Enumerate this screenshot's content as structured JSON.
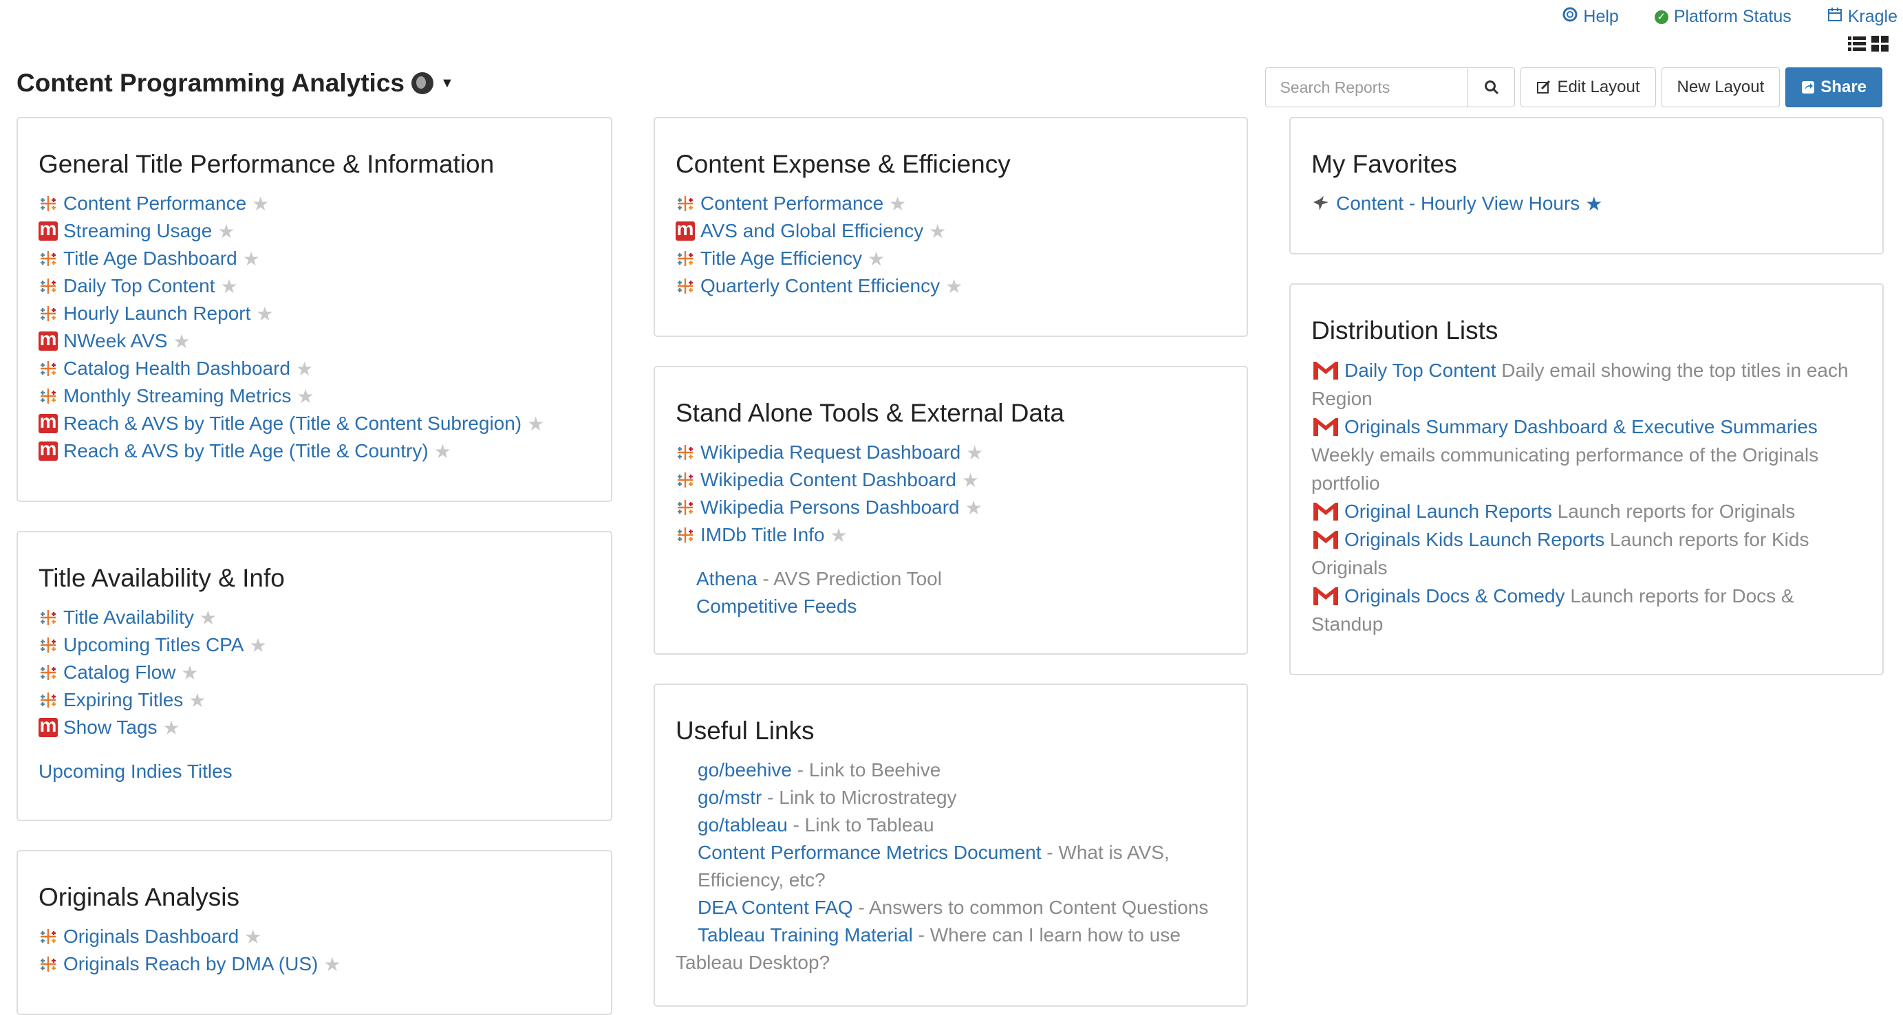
{
  "topnav": {
    "help": "Help",
    "platform_status": "Platform Status",
    "kragle": "Kragle"
  },
  "header": {
    "title": "Content Programming Analytics"
  },
  "toolbar": {
    "search_placeholder": "Search Reports",
    "edit_layout": "Edit Layout",
    "new_layout": "New Layout",
    "share": "Share"
  },
  "panels": {
    "general": {
      "title": "General Title Performance & Information",
      "items": [
        {
          "label": "Content Performance",
          "icon": "tableau-icon"
        },
        {
          "label": "Streaming Usage",
          "icon": "microstrategy-icon"
        },
        {
          "label": "Title Age Dashboard",
          "icon": "tableau-icon"
        },
        {
          "label": "Daily Top Content",
          "icon": "tableau-icon"
        },
        {
          "label": "Hourly Launch Report",
          "icon": "tableau-icon"
        },
        {
          "label": "NWeek AVS",
          "icon": "microstrategy-icon"
        },
        {
          "label": "Catalog Health Dashboard",
          "icon": "tableau-icon"
        },
        {
          "label": "Monthly Streaming Metrics",
          "icon": "tableau-icon"
        },
        {
          "label": "Reach & AVS by Title Age (Title & Content Subregion)",
          "icon": "microstrategy-icon"
        },
        {
          "label": "Reach & AVS by Title Age (Title & Country)",
          "icon": "microstrategy-icon"
        }
      ]
    },
    "availability": {
      "title": "Title Availability & Info",
      "items": [
        {
          "label": "Title Availability",
          "icon": "tableau-icon"
        },
        {
          "label": "Upcoming Titles CPA",
          "icon": "tableau-icon"
        },
        {
          "label": "Catalog Flow",
          "icon": "tableau-icon"
        },
        {
          "label": "Expiring Titles",
          "icon": "tableau-icon"
        },
        {
          "label": "Show Tags",
          "icon": "microstrategy-icon"
        }
      ],
      "extra_link": "Upcoming Indies Titles"
    },
    "originals": {
      "title": "Originals Analysis",
      "items": [
        {
          "label": "Originals Dashboard",
          "icon": "tableau-icon"
        },
        {
          "label": "Originals Reach by DMA (US)",
          "icon": "tableau-icon"
        }
      ]
    },
    "expense": {
      "title": "Content Expense & Efficiency",
      "items": [
        {
          "label": "Content Performance",
          "icon": "tableau-icon"
        },
        {
          "label": "AVS and Global Efficiency",
          "icon": "microstrategy-icon"
        },
        {
          "label": "Title Age Efficiency",
          "icon": "tableau-icon"
        },
        {
          "label": "Quarterly Content Efficiency",
          "icon": "tableau-icon"
        }
      ]
    },
    "standalone": {
      "title": "Stand Alone Tools & External Data",
      "items": [
        {
          "label": "Wikipedia Request Dashboard",
          "icon": "tableau-icon"
        },
        {
          "label": "Wikipedia Content Dashboard",
          "icon": "tableau-icon"
        },
        {
          "label": "Wikipedia Persons Dashboard",
          "icon": "tableau-icon"
        },
        {
          "label": "IMDb Title Info",
          "icon": "tableau-icon"
        }
      ],
      "athena_link": "Athena",
      "athena_desc": " - AVS Prediction Tool",
      "competitive_link": "Competitive Feeds"
    },
    "useful": {
      "title": "Useful Links",
      "links": [
        {
          "link": "go/beehive",
          "desc": " - Link to Beehive"
        },
        {
          "link": "go/mstr",
          "desc": " - Link to Microstrategy"
        },
        {
          "link": "go/tableau",
          "desc": " - Link to Tableau"
        },
        {
          "link": "Content Performance Metrics Document",
          "desc": " - What is AVS, Efficiency, etc?"
        },
        {
          "link": "DEA Content FAQ",
          "desc": " - Answers to common Content Questions"
        },
        {
          "link": "Tableau Training Material",
          "desc": " - Where can I learn how to use Tableau Desktop?"
        }
      ]
    },
    "favorites": {
      "title": "My Favorites",
      "items": [
        {
          "label": "Content - Hourly View Hours",
          "icon": "bird-icon"
        }
      ]
    },
    "distribution": {
      "title": "Distribution Lists",
      "items": [
        {
          "link": "Daily Top Content",
          "desc": " Daily email showing the top titles in each Region"
        },
        {
          "link": "Originals Summary Dashboard & Executive Summaries",
          "desc": " Weekly emails communicating performance of the Originals portfolio"
        },
        {
          "link": "Original Launch Reports",
          "desc": " Launch reports for Originals"
        },
        {
          "link": "Originals Kids Launch Reports",
          "desc": " Launch reports for Kids Originals"
        },
        {
          "link": "Originals Docs & Comedy",
          "desc": " Launch reports for Docs & Standup"
        }
      ]
    }
  },
  "colors": {
    "link": "#2a6fb0",
    "primary_button": "#337ab7",
    "microstrategy_red": "#d32a2a",
    "star_off": "#c8c8c8",
    "star_on": "#2a6fb0"
  }
}
